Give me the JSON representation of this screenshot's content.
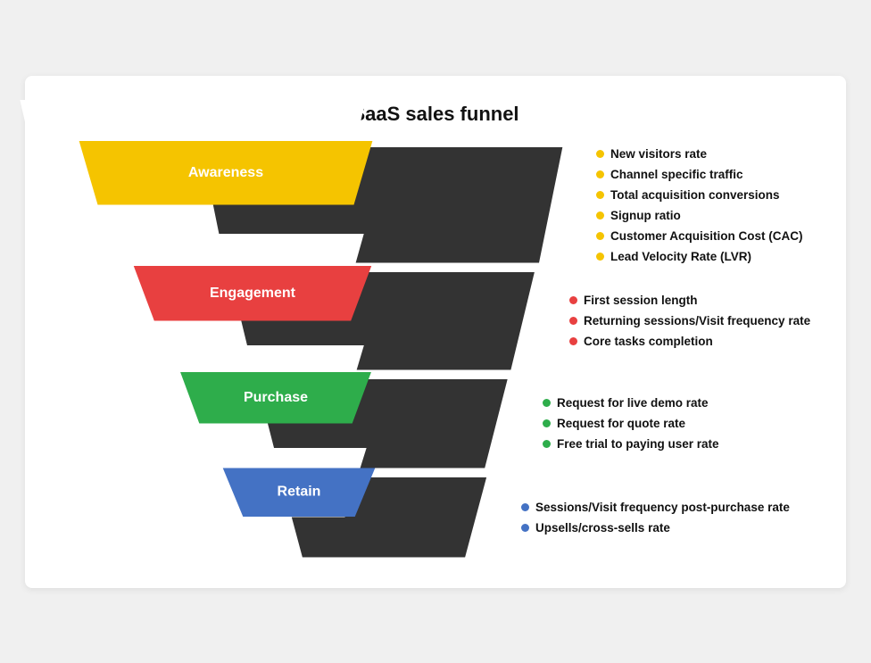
{
  "title": "SaaS sales funnel",
  "levels": [
    {
      "id": "awareness",
      "label": "Awareness",
      "color": "#F5C400",
      "dot_color": "#F5C400",
      "metrics": [
        "New visitors rate",
        "Channel specific traffic",
        "Total acquisition conversions",
        "Signup ratio",
        "Customer Acquisition Cost (CAC)",
        "Lead Velocity Rate (LVR)"
      ]
    },
    {
      "id": "engagement",
      "label": "Engagement",
      "color": "#E84040",
      "dot_color": "#E84040",
      "metrics": [
        "First session length",
        "Returning sessions/Visit frequency rate",
        "Core tasks completion"
      ]
    },
    {
      "id": "purchase",
      "label": "Purchase",
      "color": "#2EAD4B",
      "dot_color": "#2EAD4B",
      "metrics": [
        "Request for live demo rate",
        "Request for quote rate",
        "Free trial to paying user rate"
      ]
    },
    {
      "id": "retain",
      "label": "Retain",
      "color": "#4472C4",
      "dot_color": "#4472C4",
      "metrics": [
        "Sessions/Visit frequency post-purchase rate",
        "Upsells/cross-sells rate"
      ]
    }
  ]
}
